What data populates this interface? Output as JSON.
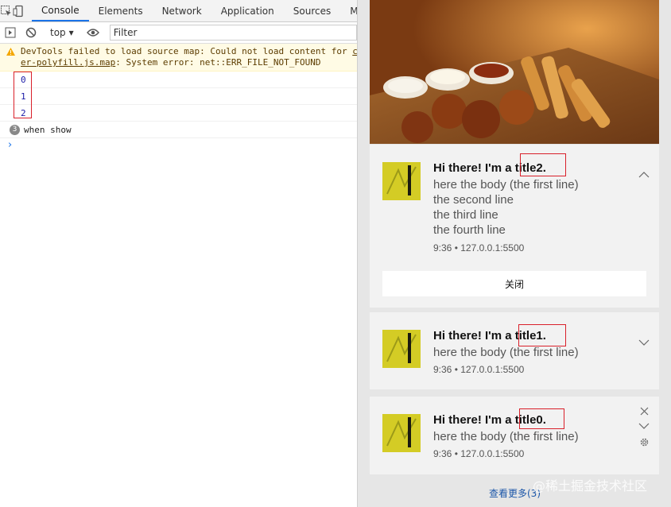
{
  "devtools": {
    "tabs": [
      "Console",
      "Elements",
      "Network",
      "Application",
      "Sources",
      "M"
    ],
    "context": "top",
    "filter_placeholder": "Filter",
    "warning": {
      "prefix": "DevTools failed to load source map: Could not load content for ",
      "link_a": "c",
      "link_b": "er-polyfill.js.map",
      "suffix": ": System error: net::ERR_FILE_NOT_FOUND"
    },
    "logs": [
      "0",
      "1",
      "2"
    ],
    "message": {
      "count": "3",
      "text": "when show"
    },
    "prompt": "›"
  },
  "notifications": [
    {
      "title_prefix": "Hi there! I'm a ",
      "title_highlight": "title2.",
      "body": [
        "here the body (the first line)",
        "the second line",
        "the third line",
        "the fourth line"
      ],
      "meta": "9:36 • 127.0.0.1:5500",
      "button": "关闭"
    },
    {
      "title_prefix": "Hi there! I'm a ",
      "title_highlight": "title1.",
      "body": [
        "here the body (the first line)"
      ],
      "meta": "9:36 • 127.0.0.1:5500"
    },
    {
      "title_prefix": "Hi there! I'm a ",
      "title_highlight": "title0.",
      "body": [
        "here the body (the first line)"
      ],
      "meta": "9:36 • 127.0.0.1:5500"
    }
  ],
  "see_more": "查看更多(3)",
  "watermark": "@稀土掘金技术社区",
  "colors": {
    "accent": "#1a73e8",
    "highlight_box": "#d9202a",
    "warning_bg": "#fffbe5"
  }
}
